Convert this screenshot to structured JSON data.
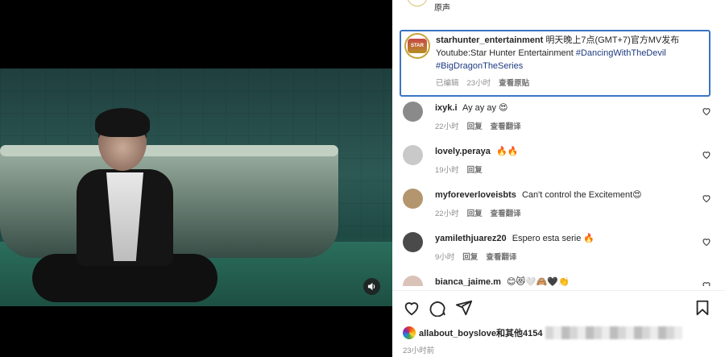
{
  "audio": {
    "label": "原声"
  },
  "caption": {
    "avatar_text": "STAR",
    "username": "starhunter_entertainment",
    "text": "明天晚上7点(GMT+7)官方MV发布",
    "line2": "Youtube:Star Hunter Entertainment",
    "hashtag1": "#DancingWithTheDevil",
    "hashtag2": "#BigDragonTheSeries",
    "edited": "已编辑",
    "time": "23小时",
    "see_original": "查看原贴"
  },
  "comments": [
    {
      "username": "ixyk.i",
      "text": "Ay ay ay 😍",
      "time": "22小时",
      "reply": "回复",
      "translate": "查看翻译",
      "avatar_color": "#8a8a8a"
    },
    {
      "username": "lovely.peraya",
      "text": "🔥🔥",
      "time": "19小时",
      "reply": "回复",
      "translate": "",
      "avatar_color": "#c9c9c9"
    },
    {
      "username": "myforeverloveisbts",
      "text": "Can't control the Excitement😍",
      "time": "22小时",
      "reply": "回复",
      "translate": "查看翻译",
      "avatar_color": "#b3966e"
    },
    {
      "username": "yamilethjuarez20",
      "text": "Espero esta serie 🔥",
      "time": "9小时",
      "reply": "回复",
      "translate": "查看翻译",
      "avatar_color": "#4a4a4a"
    },
    {
      "username": "bianca_jaime.m",
      "text": "😊😻🤍🙈🖤👏",
      "time": "",
      "reply": "",
      "translate": "",
      "avatar_color": "#d9c2b8"
    }
  ],
  "likes": {
    "text": "allabout_boyslove和其他4154"
  },
  "post_time": "23小时前",
  "colors": {
    "caption_border": "#3b74c4",
    "hashtag": "#1d3a80",
    "muted": "#8e8e8e"
  }
}
